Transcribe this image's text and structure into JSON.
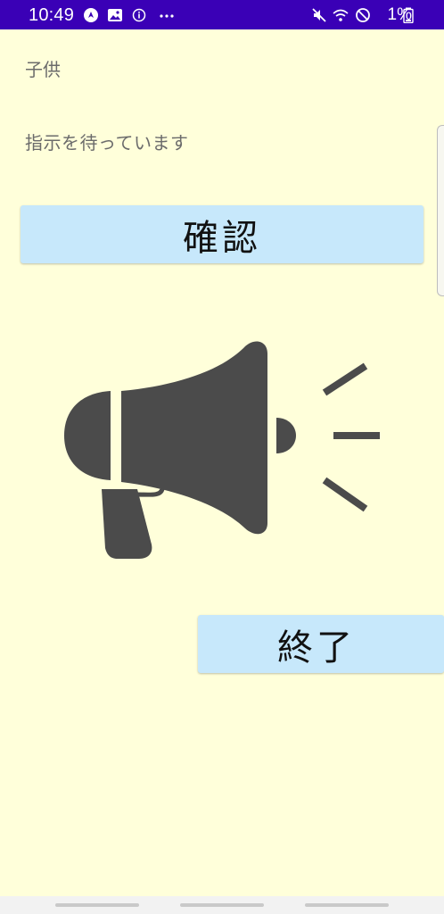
{
  "status_bar": {
    "time": "10:49",
    "battery": "1%",
    "left_icons": [
      "navigation-icon",
      "image-icon",
      "info-icon",
      "more-icon"
    ],
    "right_icons": [
      "mute-icon",
      "wifi-icon",
      "do-not-disturb-icon",
      "battery-icon"
    ],
    "background": "#3a00b6"
  },
  "main": {
    "role_label": "子供",
    "status_text": "指示を待っています",
    "confirm_button_label": "確認",
    "end_button_label": "終了",
    "illustration_icon": "megaphone-icon",
    "background": "#ffffda",
    "button_color": "#c7e8fb"
  }
}
